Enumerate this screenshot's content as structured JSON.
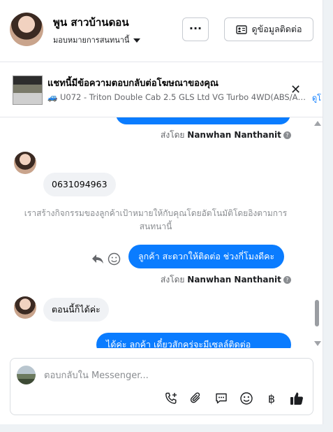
{
  "header": {
    "name": "พูน สาวบ้านดอน",
    "assign_label": "มอบหมายการสนทนานี้",
    "more_label": "···",
    "contact_button_label": "ดูข้อมูลติดต่อ"
  },
  "ad_banner": {
    "title": "แชทนี้มีข้อความตอบกลับต่อโฆษณาของคุณ",
    "subtitle": "U072 - Triton Double Cab 2.5 GLS Ltd VG Turbo 4WD(ABS/Air...",
    "link_label": "ดูโ"
  },
  "messages": {
    "sent_by_prefix": "ส่งโดย",
    "sender": "Nanwhan Nanthanit",
    "help_mark": "?",
    "incoming_phone": "0631094963",
    "system_note": "เราสร้างกิจกรรมของลูกค้าเป้าหมายให้กับคุณโดยอัตโนมัติโดยอิงตามการสนทนานี้",
    "outgoing_1": "ลูกค้า  สะดวกให้ติดต่อ ช่วงกี่โมงดีคะ",
    "incoming_2": "ตอนนี้ก็ได้ค่ะ",
    "outgoing_2": "ได้ค่ะ  ลูกค้า เดี๋ยวสักครู่จะมีเซลล์ติดต่อ"
  },
  "composer": {
    "placeholder": "ตอบกลับใน Messenger...",
    "baht_symbol": "฿"
  },
  "colors": {
    "accent": "#0a7cff",
    "incoming_bubble": "#f0f2f5",
    "muted_text": "#65676b"
  },
  "icons": [
    "more-icon",
    "contact-card-icon",
    "close-icon",
    "reply-icon",
    "emoji-icon",
    "call-add-icon",
    "attach-icon",
    "saved-reply-icon",
    "baht-icon",
    "like-icon"
  ]
}
